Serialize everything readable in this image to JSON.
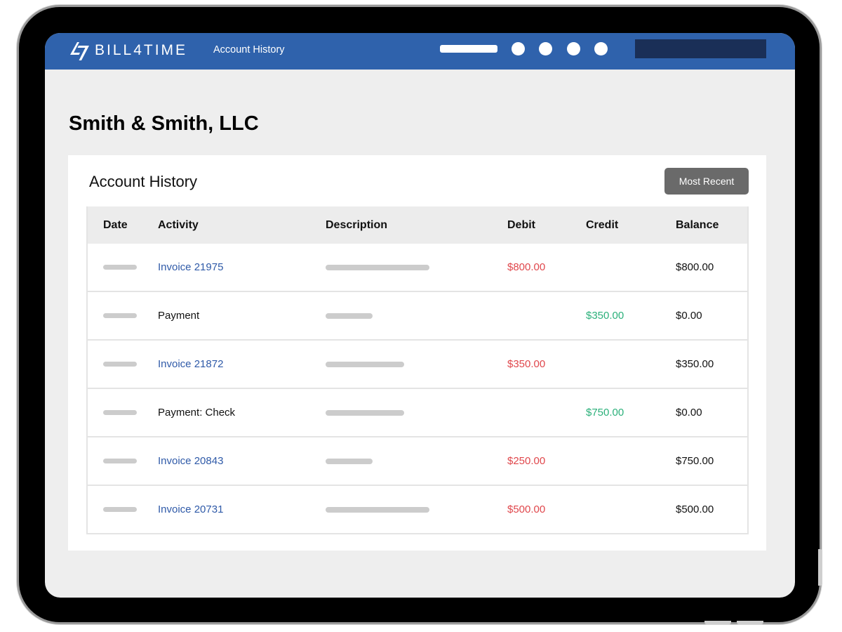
{
  "brand": {
    "logo_text": "BILL4TIME",
    "mark_icon": "bill4time-logo-icon",
    "color": "#2f62ac"
  },
  "topbar": {
    "title": "Account History"
  },
  "page": {
    "client_name": "Smith & Smith, LLC"
  },
  "history": {
    "title": "Account History",
    "sort_label": "Most Recent",
    "columns": [
      "Date",
      "Activity",
      "Description",
      "Debit",
      "Credit",
      "Balance"
    ],
    "rows": [
      {
        "activity": "Invoice 21975",
        "is_link": true,
        "debit": "$800.00",
        "credit": "",
        "balance": "$800.00",
        "desc_length": "long"
      },
      {
        "activity": "Payment",
        "is_link": false,
        "debit": "",
        "credit": "$350.00",
        "balance": "$0.00",
        "desc_length": "short"
      },
      {
        "activity": "Invoice 21872",
        "is_link": true,
        "debit": "$350.00",
        "credit": "",
        "balance": "$350.00",
        "desc_length": "medium"
      },
      {
        "activity": "Payment: Check",
        "is_link": false,
        "debit": "",
        "credit": "$750.00",
        "balance": "$0.00",
        "desc_length": "medium"
      },
      {
        "activity": "Invoice 20843",
        "is_link": true,
        "debit": "$250.00",
        "credit": "",
        "balance": "$750.00",
        "desc_length": "short"
      },
      {
        "activity": "Invoice 20731",
        "is_link": true,
        "debit": "$500.00",
        "credit": "",
        "balance": "$500.00",
        "desc_length": "long"
      }
    ]
  },
  "colors": {
    "debit": "#e0474c",
    "credit": "#2bb07a",
    "link": "#2f5aa8",
    "search_box": "#1a2f57"
  }
}
